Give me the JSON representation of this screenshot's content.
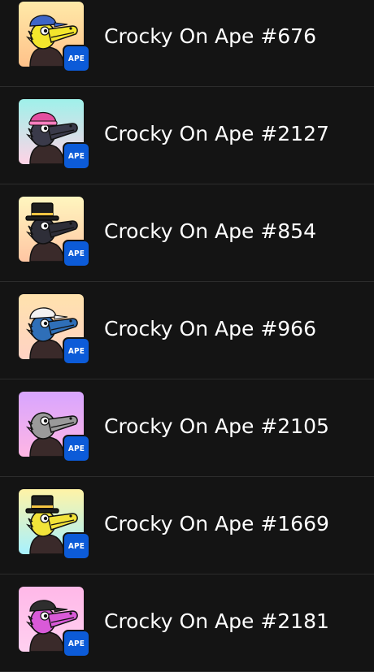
{
  "chain_badge_label": "APE",
  "items": [
    {
      "name": "Crocky On Ape #676",
      "bg_top": "#ffe9a8",
      "bg_bottom": "#ffc28a",
      "skin": "#f3e62c",
      "hat": "blue-cap",
      "avatar_icon": "crocodile-nft-icon"
    },
    {
      "name": "Crocky On Ape #2127",
      "bg_top": "#9ff1ea",
      "bg_bottom": "#ffd3e6",
      "skin": "#3a3a4a",
      "hat": "pink-beanie",
      "avatar_icon": "crocodile-nft-icon"
    },
    {
      "name": "Crocky On Ape #854",
      "bg_top": "#fff6bf",
      "bg_bottom": "#ffc6a3",
      "skin": "#2e2e38",
      "hat": "black-top-hat",
      "avatar_icon": "crocodile-nft-icon"
    },
    {
      "name": "Crocky On Ape #966",
      "bg_top": "#ffe2ad",
      "bg_bottom": "#ffd2c4",
      "skin": "#2f6fb8",
      "hat": "white-cap",
      "avatar_icon": "crocodile-nft-icon"
    },
    {
      "name": "Crocky On Ape #2105",
      "bg_top": "#d8a5ff",
      "bg_bottom": "#ffb6e4",
      "skin": "#9a9a9a",
      "hat": "none",
      "avatar_icon": "crocodile-nft-icon"
    },
    {
      "name": "Crocky On Ape #1669",
      "bg_top": "#fff3a6",
      "bg_bottom": "#a7f2ff",
      "skin": "#f2e33a",
      "hat": "black-top-hat",
      "avatar_icon": "crocodile-nft-icon"
    },
    {
      "name": "Crocky On Ape #2181",
      "bg_top": "#ffb8e8",
      "bg_bottom": "#ffd0f0",
      "skin": "#d95ad8",
      "hat": "green-cap",
      "avatar_icon": "crocodile-nft-icon"
    }
  ]
}
